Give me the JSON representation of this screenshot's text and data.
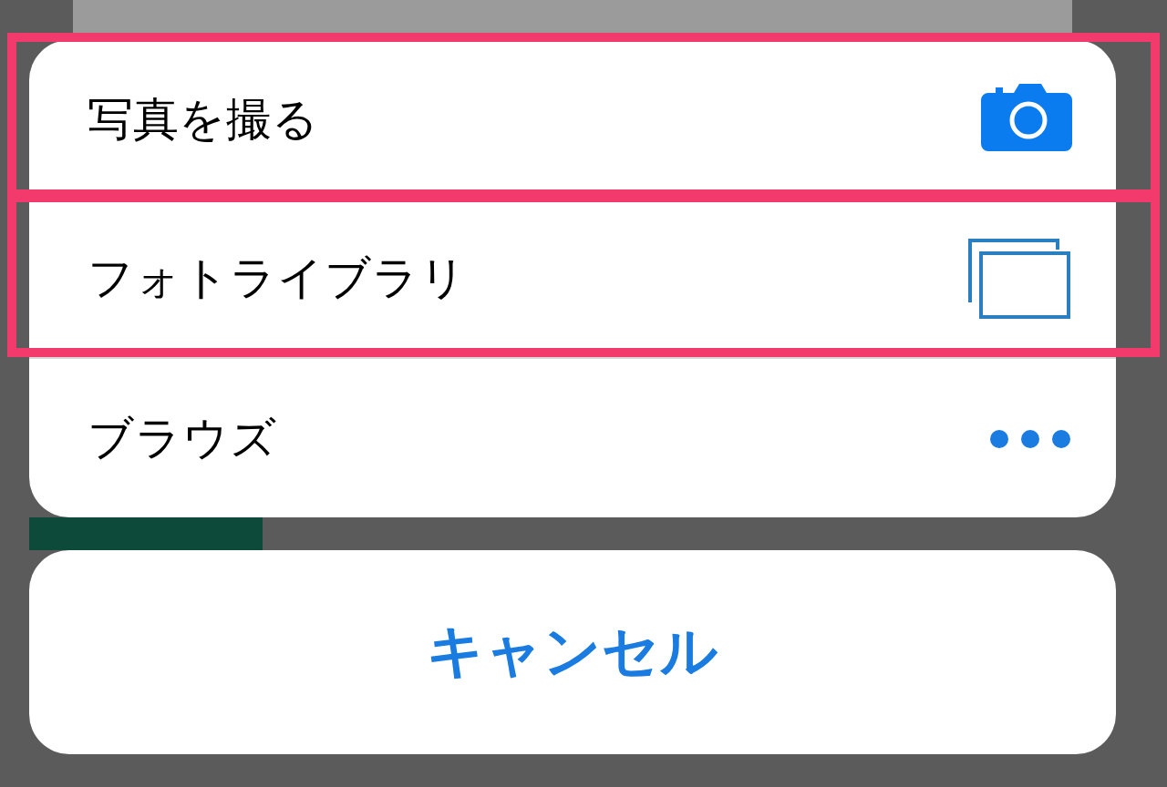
{
  "action_sheet": {
    "options": [
      {
        "label": "写真を撮る",
        "kind": "camera",
        "highlighted": true
      },
      {
        "label": "フォトライブラリ",
        "kind": "library",
        "highlighted": true
      },
      {
        "label": "ブラウズ",
        "kind": "more",
        "highlighted": false
      }
    ]
  },
  "cancel_button": {
    "label": "キャンセル"
  }
}
